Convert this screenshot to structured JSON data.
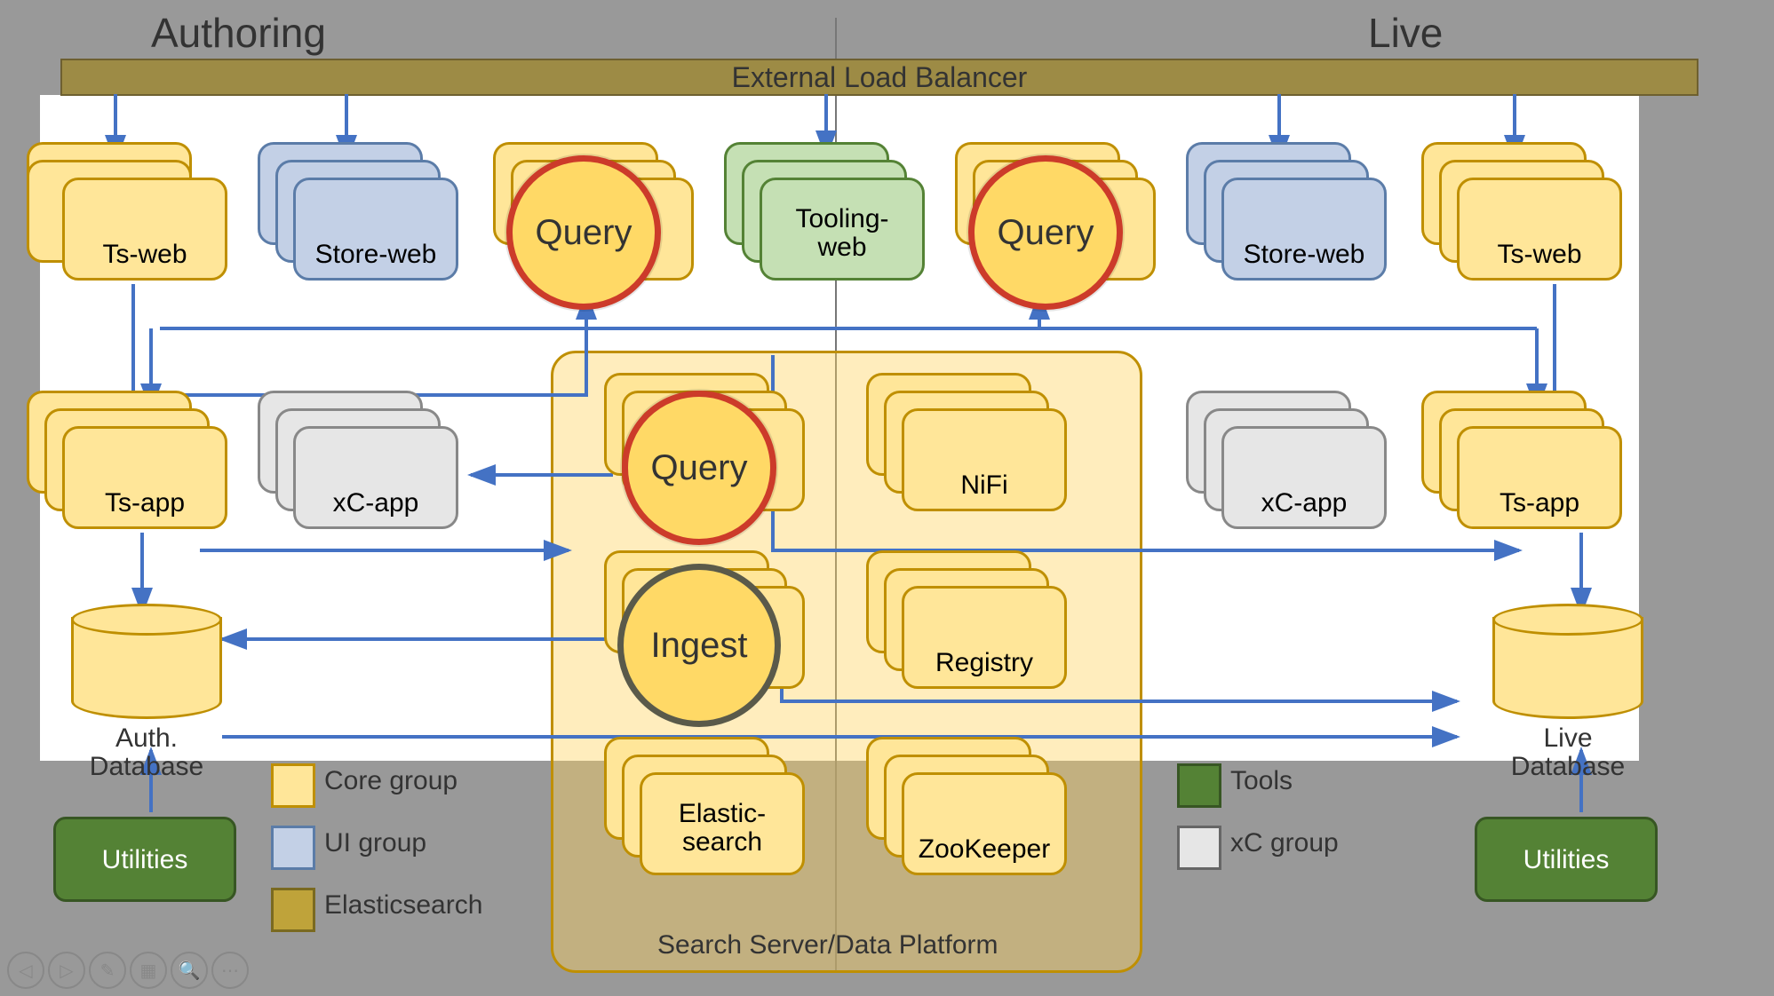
{
  "headers": {
    "left": "Authoring",
    "right": "Live"
  },
  "loadBalancer": "External Load Balancer",
  "row1": {
    "tsweb_auth": "Ts-web",
    "storeweb_auth": "Store-web",
    "query_auth": "Query",
    "toolingweb": "Tooling-\nweb",
    "query_live": "Query",
    "storeweb_live": "Store-web",
    "tsweb_live": "Ts-web"
  },
  "row2": {
    "tsapp_auth": "Ts-app",
    "xcapp_auth": "xC-app",
    "query_mid": "Query",
    "nifi": "NiFi",
    "xcapp_live": "xC-app",
    "tsapp_live": "Ts-app"
  },
  "row3": {
    "ingest": "Ingest",
    "registry": "Registry",
    "elastic": "Elastic-\nsearch",
    "zookeeper": "ZooKeeper"
  },
  "db": {
    "auth": "Auth.\nDatabase",
    "live": "Live\nDatabase"
  },
  "utilities": "Utilities",
  "platformLabel": "Search Server/Data Platform",
  "legend": {
    "core": "Core group",
    "ui": "UI group",
    "elastic": "Elasticsearch",
    "tools": "Tools",
    "xc": "xC group"
  },
  "colors": {
    "yellow": "#ffe699",
    "yellowBorder": "#bf8f00",
    "blue": "#c3d0e6",
    "blueBorder": "#5b7ca8",
    "green": "#c5e0b4",
    "greenBorder": "#548235",
    "grey": "#e6e6e6",
    "greyBorder": "#888",
    "elasticFill": "#bfa33a",
    "arrow": "#4472c4"
  }
}
